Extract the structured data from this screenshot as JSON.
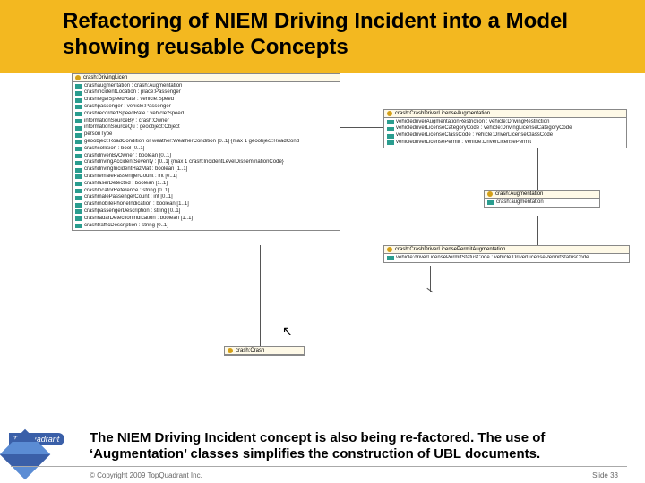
{
  "header": {
    "title": "Refactoring of NIEM Driving Incident into a Model showing reusable Concepts"
  },
  "classes": {
    "drivingLicen": {
      "name": "crash:DrivingLicen",
      "attrs": [
        "crashaugmentation : crash:Augmentation",
        "crashincidentLocation : place:Passenger",
        "crashlegalSpeedRate : vehicle:Speed",
        "crashpassenger : vehicle:Passenger",
        "crashrecordedSpeedRate : vehicle:Speed",
        "informationSourceBy : crash:Owner",
        "informationSourceQu : geoobject:Object",
        "personType",
        "geoobject:RoadCondition or weather:WeatherCondition [0..1] {max 1 geoobject:RoadCond",
        "crashcollision : bool [0..1]",
        "crashdrivenByOwner : boolean [0..1]",
        "crashdrivingAccidentSeverity : [0..1] {max 1 crash:IncidentLevelDisseminationCode}",
        "crashdrivingIncidentHazMat : boolean [1..1]",
        "crashfemalePassengerCount : int [0..1]",
        "crashlaserDetected : boolean [1..1]",
        "crashlocatorReference : string [0..1]",
        "crashmalePassengerCount : int [0..1]",
        "crashmobilePhoneIndication : boolean [1..1]",
        "crashpassengerDescription : string [0..1]",
        "crashradarDetectionIndication : boolean [1..1]",
        "crashtrafficDescription : string [0..1]"
      ]
    },
    "driverAug": {
      "name": "crash:CrashDriverLicenseAugmentation",
      "attrs": [
        "vehicledriverAugmentationRestriction : vehicle:DrivingRestriction",
        "vehicledriverLicenseCategoryCode : vehicle:DrivingLicenseCategoryCode",
        "vehicledriverLicenseClassCode : vehicle:DriverLicenseClassCode",
        "vehicledriverLicensePermit : vehicle:DriverLicensePermit"
      ]
    },
    "augmentation": {
      "name": "crash:Augmentation",
      "attrs": [
        "crash:augmentation"
      ]
    },
    "permitAug": {
      "name": "crash:CrashDriverLicensePermitAugmentation",
      "attrs": [
        "vehicle:driverLicensePermitStatusCode : vehicle:DriverLicensePermitStatusCode"
      ]
    },
    "crash": {
      "name": "crash:Crash",
      "attrs": []
    }
  },
  "footer": {
    "logo": "TopQuadrant",
    "text": "The NIEM Driving Incident concept is also being re-factored. The use of ‘Augmentation’ classes simplifies the construction of UBL documents.",
    "copyright": "© Copyright 2009 TopQuadrant Inc.",
    "slide": "Slide 33"
  }
}
